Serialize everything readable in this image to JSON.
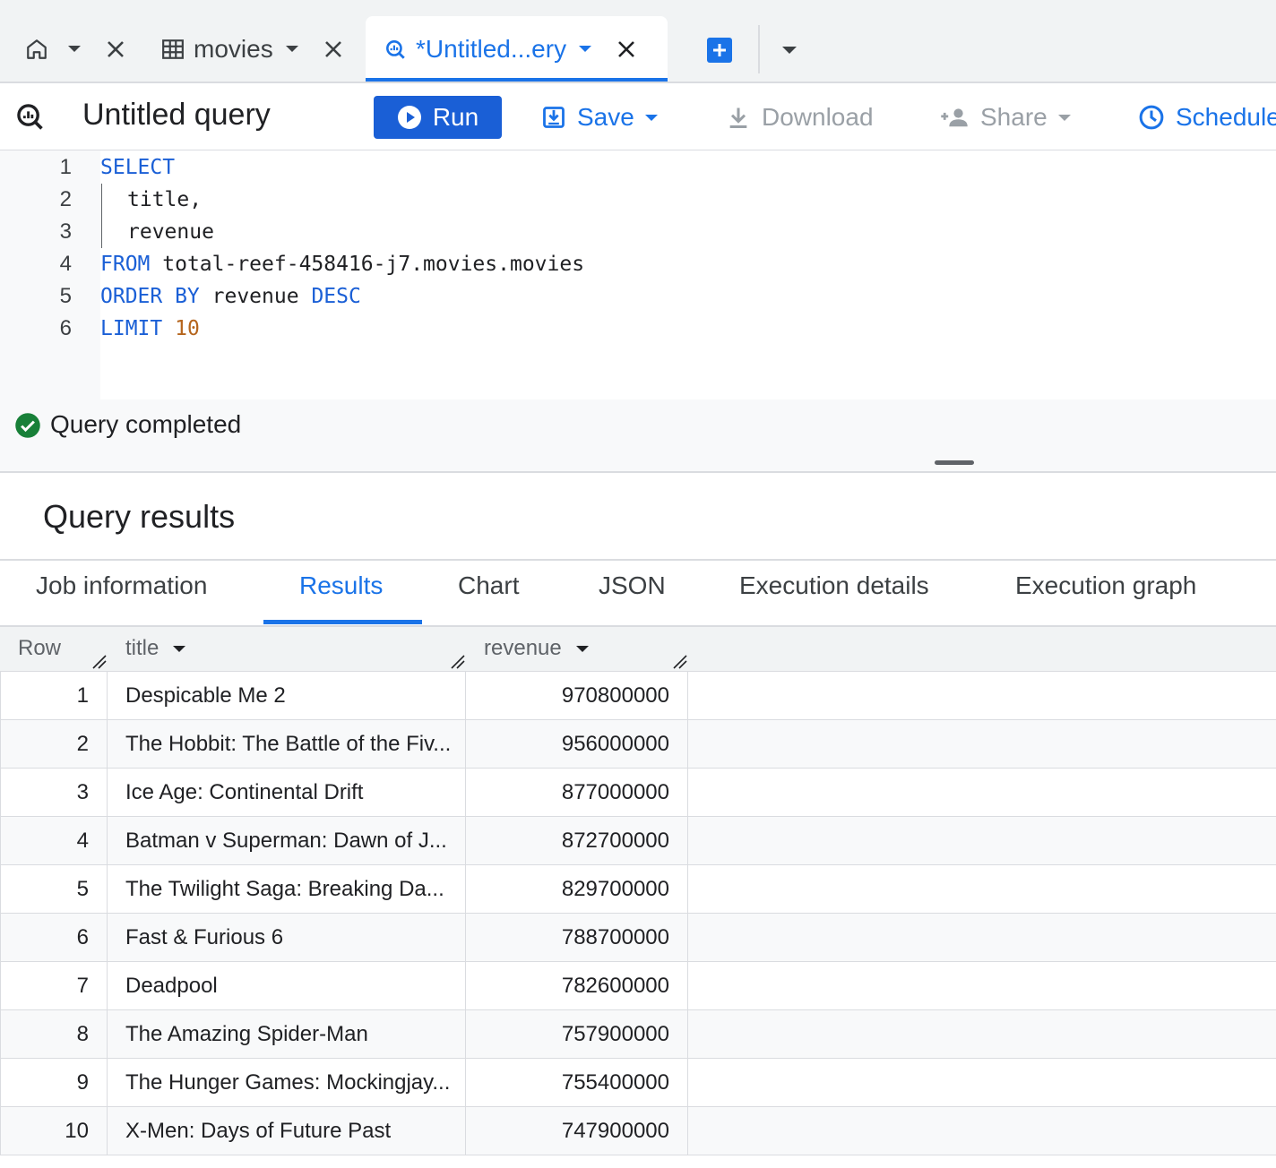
{
  "tabs": [
    {
      "label": "",
      "icon": "home-icon"
    },
    {
      "label": "movies",
      "icon": "table-icon"
    },
    {
      "label": "*Untitled...ery",
      "icon": "query-icon",
      "active": true
    }
  ],
  "toolbar": {
    "title": "Untitled query",
    "run_label": "Run",
    "save_label": "Save",
    "download_label": "Download",
    "share_label": "Share",
    "schedule_label": "Schedule"
  },
  "editor": {
    "line_numbers": [
      "1",
      "2",
      "3",
      "4",
      "5",
      "6"
    ],
    "line1_kw": "SELECT",
    "line2": "title,",
    "line3": "revenue",
    "line4_kw": "FROM",
    "line4_rest": "total-reef-458416-j7.movies.movies",
    "line5_kw1": "ORDER BY",
    "line5_ident": "revenue",
    "line5_kw2": "DESC",
    "line6_kw": "LIMIT",
    "line6_num": "10"
  },
  "status": {
    "text": "Query completed"
  },
  "results": {
    "title": "Query results",
    "tabs": [
      "Job information",
      "Results",
      "Chart",
      "JSON",
      "Execution details",
      "Execution graph"
    ],
    "active_tab": "Results",
    "columns": [
      "Row",
      "title",
      "revenue"
    ],
    "rows": [
      {
        "row": "1",
        "title": "Despicable Me 2",
        "revenue": "970800000"
      },
      {
        "row": "2",
        "title": "The Hobbit: The Battle of the Fiv...",
        "revenue": "956000000"
      },
      {
        "row": "3",
        "title": "Ice Age: Continental Drift",
        "revenue": "877000000"
      },
      {
        "row": "4",
        "title": "Batman v Superman: Dawn of J...",
        "revenue": "872700000"
      },
      {
        "row": "5",
        "title": "The Twilight Saga: Breaking Da...",
        "revenue": "829700000"
      },
      {
        "row": "6",
        "title": "Fast & Furious 6",
        "revenue": "788700000"
      },
      {
        "row": "7",
        "title": "Deadpool",
        "revenue": "782600000"
      },
      {
        "row": "8",
        "title": "The Amazing Spider-Man",
        "revenue": "757900000"
      },
      {
        "row": "9",
        "title": "The Hunger Games: Mockingjay...",
        "revenue": "755400000"
      },
      {
        "row": "10",
        "title": "X-Men: Days of Future Past",
        "revenue": "747900000"
      }
    ]
  },
  "colors": {
    "accent": "#1a73e8",
    "success": "#188038"
  }
}
